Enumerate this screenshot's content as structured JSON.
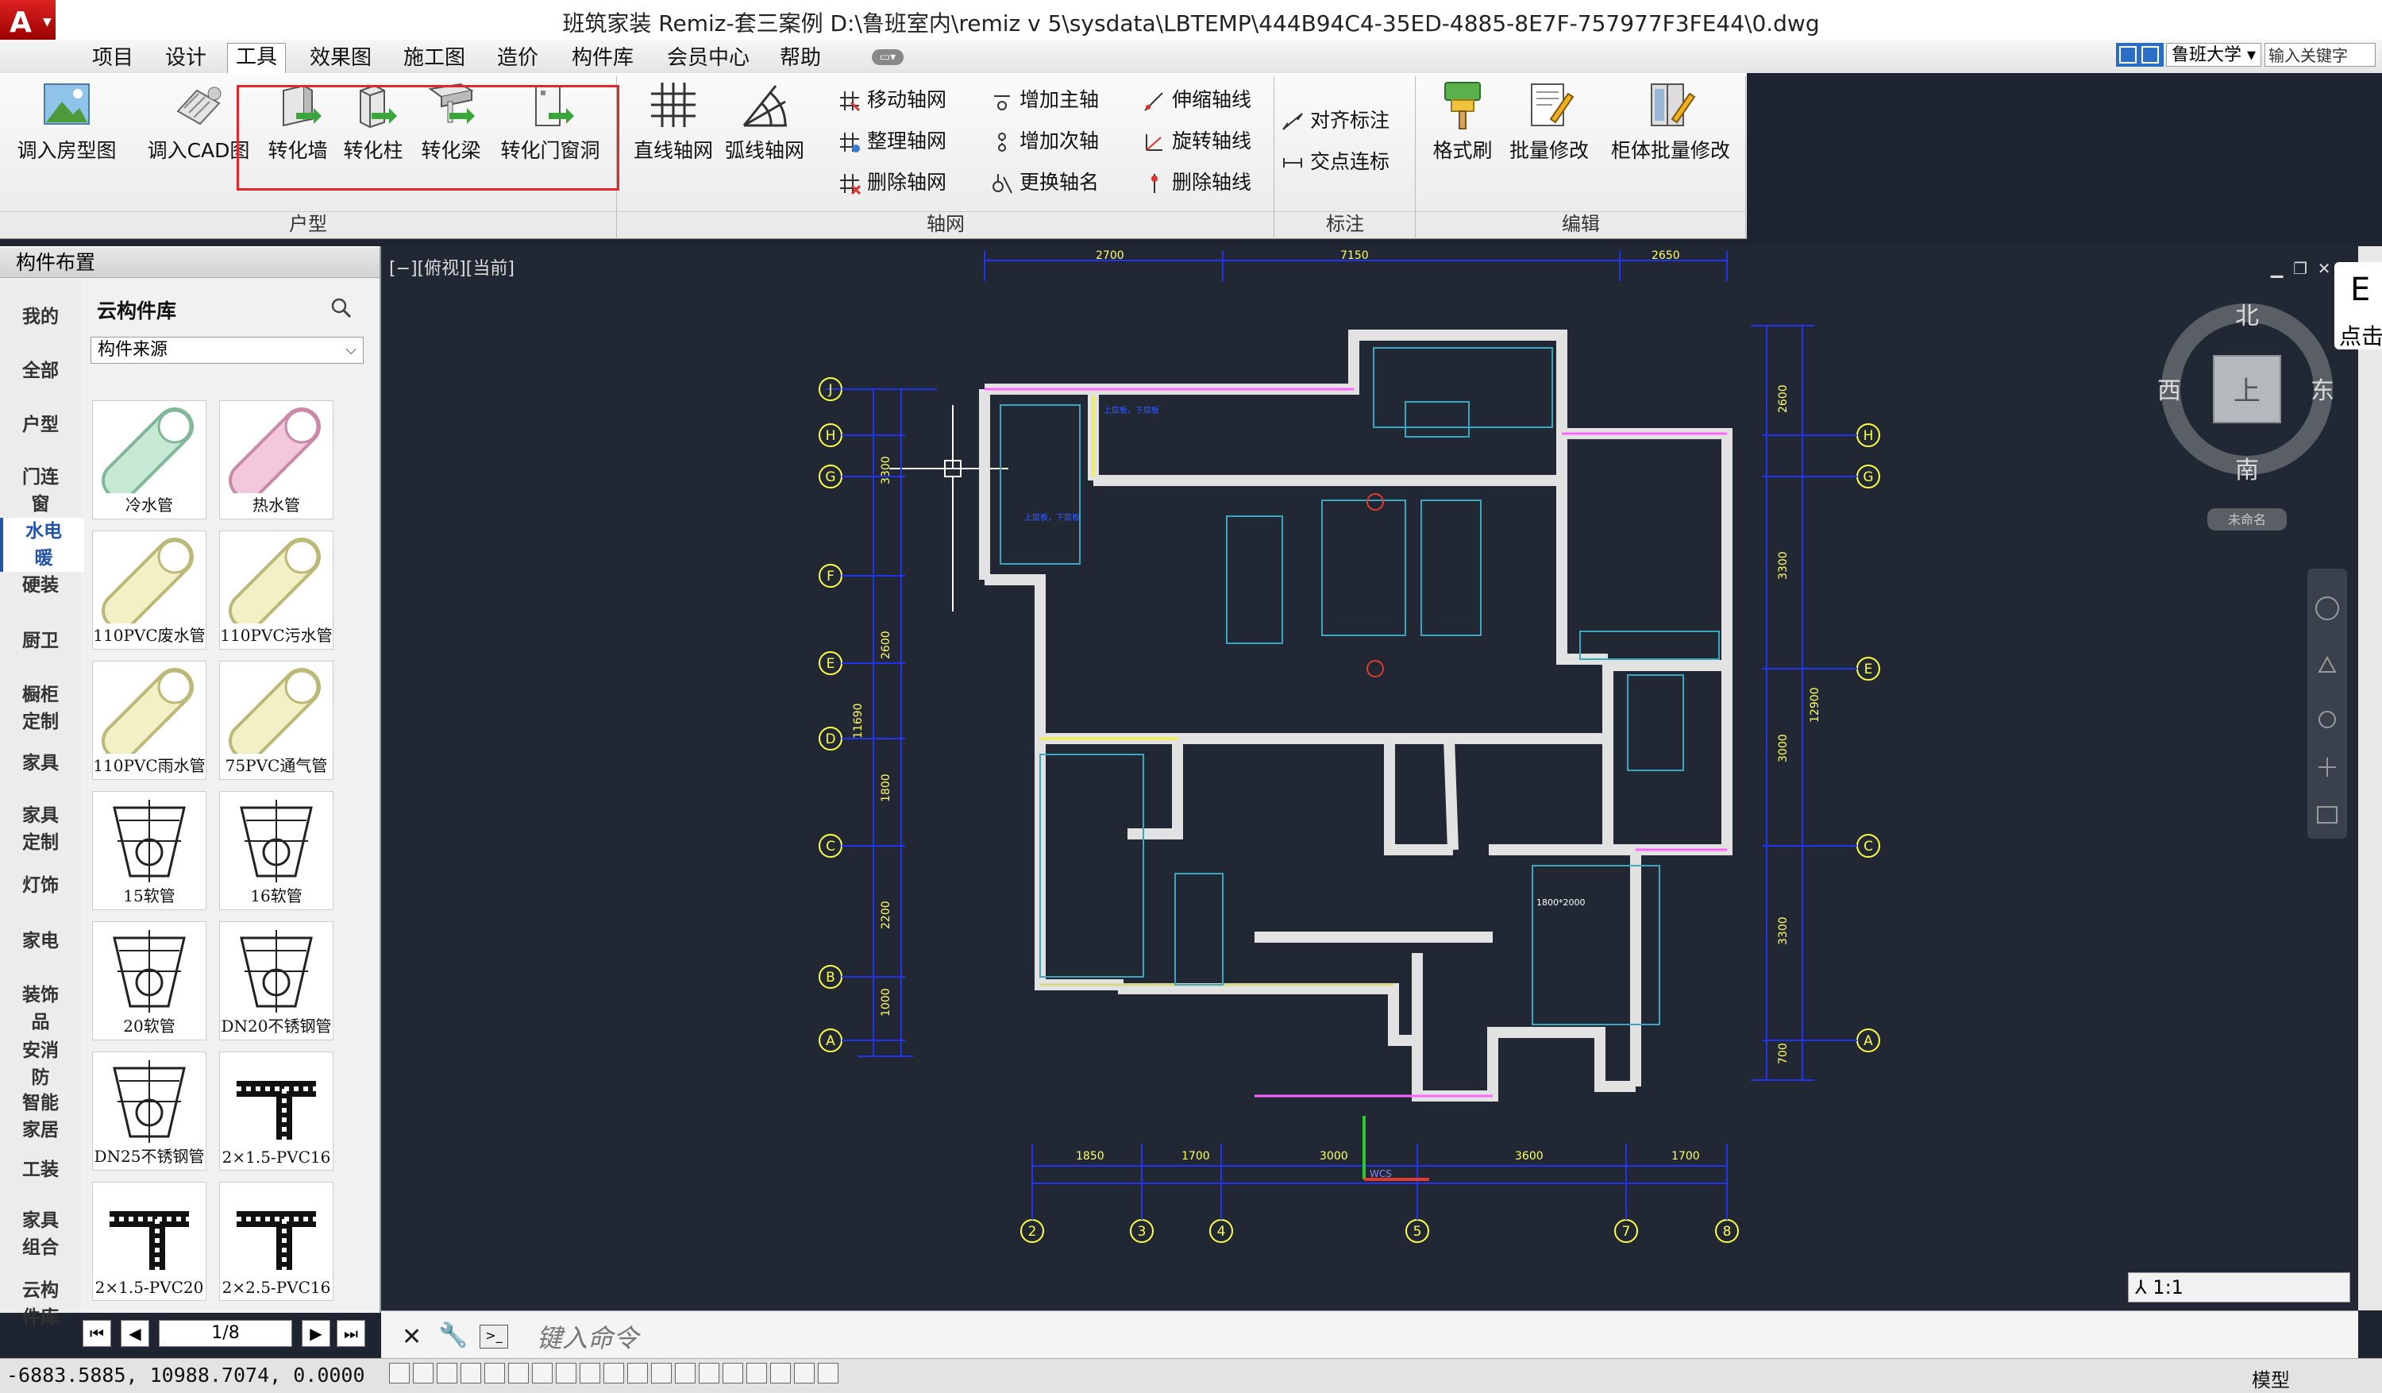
{
  "app": {
    "title": "班筑家装 Remiz-套三案例     D:\\鲁班室内\\remiz v 5\\sysdata\\LBTEMP\\444B94C4-35ED-4885-8E7F-757977F3FE44\\0.dwg"
  },
  "menu": {
    "items": [
      "项目",
      "设计",
      "工具",
      "效果图",
      "施工图",
      "造价",
      "构件库",
      "会员中心",
      "帮助"
    ],
    "active": "工具",
    "university": "鲁班大学",
    "keyword_placeholder": "输入关键字"
  },
  "ribbon": {
    "panels": {
      "huxing": "户型",
      "zhouwang": "轴网",
      "biaozhu": "标注",
      "bianji": "编辑"
    },
    "big_buttons": {
      "import_floorplan": "调入房型图",
      "import_cad": "调入CAD图",
      "convert_wall": "转化墙",
      "convert_column": "转化柱",
      "convert_beam": "转化梁",
      "convert_opening": "转化门窗洞",
      "line_grid": "直线轴网",
      "arc_grid": "弧线轴网",
      "format_brush": "格式刷",
      "batch_modify": "批量修改",
      "cabinet_batch_modify": "柜体批量修改"
    },
    "small_buttons": {
      "move_grid": "移动轴网",
      "tidy_grid": "整理轴网",
      "delete_grid": "删除轴网",
      "add_main_axis": "增加主轴",
      "add_sub_axis": "增加次轴",
      "rename_axis": "更换轴名",
      "stretch_axis": "伸缩轴线",
      "rotate_axis": "旋转轴线",
      "delete_axis": "删除轴线",
      "align_dim": "对齐标注",
      "intersect_dim": "交点连标"
    }
  },
  "left_panel": {
    "title": "构件布置",
    "library_title": "云构件库",
    "source_select": "构件来源",
    "categories": [
      "我的",
      "全部",
      "户型",
      "门连窗",
      "水电暖",
      "硬装",
      "厨卫",
      "橱柜定制",
      "家具",
      "家具定制",
      "灯饰",
      "家电",
      "装饰品",
      "安消防",
      "智能家居",
      "工装",
      "家具组合",
      "云构件库"
    ],
    "active_category": "水电暖",
    "tiles": [
      "冷水管",
      "热水管",
      "110PVC废水管",
      "110PVC污水管",
      "110PVC雨水管",
      "75PVC通气管",
      "15软管",
      "16软管",
      "20软管",
      "DN20不锈钢管",
      "DN25不锈钢管",
      "2×1.5-PVC16",
      "2×1.5-PVC20",
      "2×2.5-PVC16"
    ],
    "pager": {
      "page": "1/8"
    }
  },
  "canvas": {
    "view_label": "[−][俯视][当前]",
    "compass": {
      "north": "北",
      "south": "南",
      "east": "东",
      "west": "西",
      "center": "上",
      "name": "未命名"
    },
    "callout": {
      "t1": "E",
      "t2": "点击"
    },
    "ucs_label": "WCS",
    "axes_left": [
      "J",
      "H",
      "G",
      "F",
      "E",
      "D",
      "C",
      "B",
      "A"
    ],
    "axes_right": [
      "H",
      "G",
      "E",
      "C",
      "A"
    ],
    "axes_bottom": [
      "2",
      "3",
      "4",
      "5",
      "7",
      "8"
    ],
    "dims_top": [
      "2700",
      "7150",
      "2650"
    ],
    "dims_bottom": [
      "1850",
      "1700",
      "3000",
      "3600",
      "1700"
    ],
    "dims_left": [
      "3300",
      "2600",
      "1800",
      "2200",
      "1000"
    ],
    "dims_left_total": "11690",
    "dims_right": [
      "2600",
      "3300",
      "3000",
      "3300",
      "700"
    ],
    "dims_right_total": "12900",
    "room_label": "1800*2000"
  },
  "command": {
    "placeholder": "键入命令"
  },
  "scale": {
    "value": "1:1"
  },
  "status": {
    "coords": "-6883.5885,  10988.7074, 0.0000",
    "model_tab": "模型"
  }
}
